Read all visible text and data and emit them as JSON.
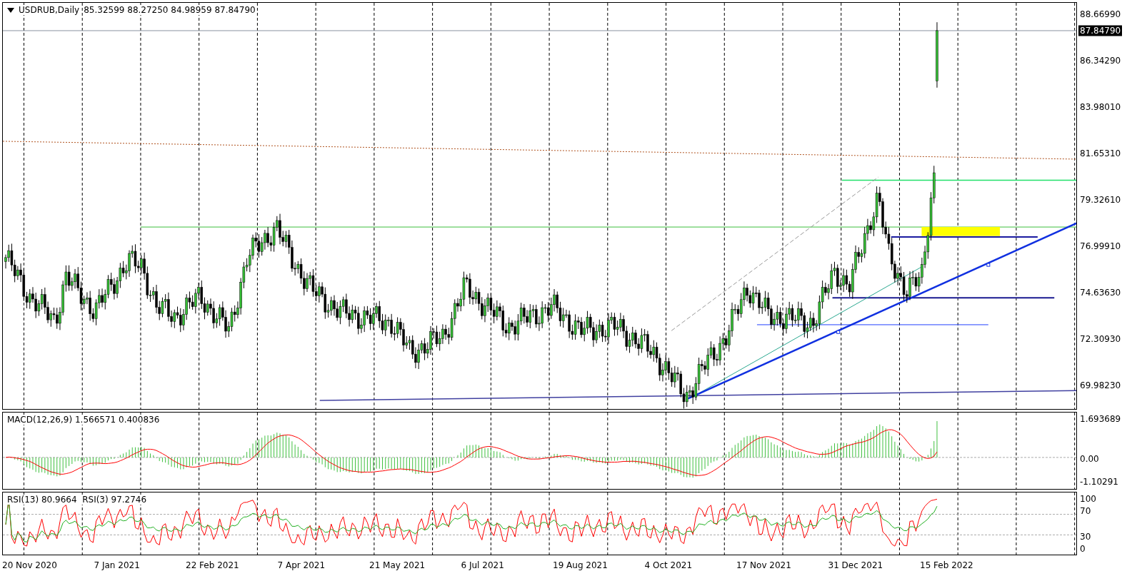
{
  "header": {
    "symbol": "USDRUB,Daily",
    "ohlc": "85.32599 88.27250 84.98959 87.84790"
  },
  "price_axis": {
    "ticks": [
      "88.66990",
      "86.34290",
      "83.98010",
      "81.65310",
      "79.32610",
      "76.99910",
      "74.63630",
      "72.30930",
      "69.98230"
    ],
    "current_price": "87.84790"
  },
  "macd": {
    "label": "MACD(12,26,9) 1.566571 0.400836",
    "ticks": [
      "1.693689",
      "0.00",
      "-1.10291"
    ]
  },
  "rsi": {
    "label": "RSI(13) 80.9664  RSI(3) 97.2746",
    "ticks": [
      "100",
      "70",
      "30",
      "0"
    ]
  },
  "time_axis": {
    "labels": [
      "20 Nov 2020",
      "7 Jan 2021",
      "22 Feb 2021",
      "7 Apr 2021",
      "21 May 2021",
      "6 Jul 2021",
      "19 Aug 2021",
      "4 Oct 2021",
      "17 Nov 2021",
      "31 Dec 2021",
      "15 Feb 2022"
    ]
  }
}
